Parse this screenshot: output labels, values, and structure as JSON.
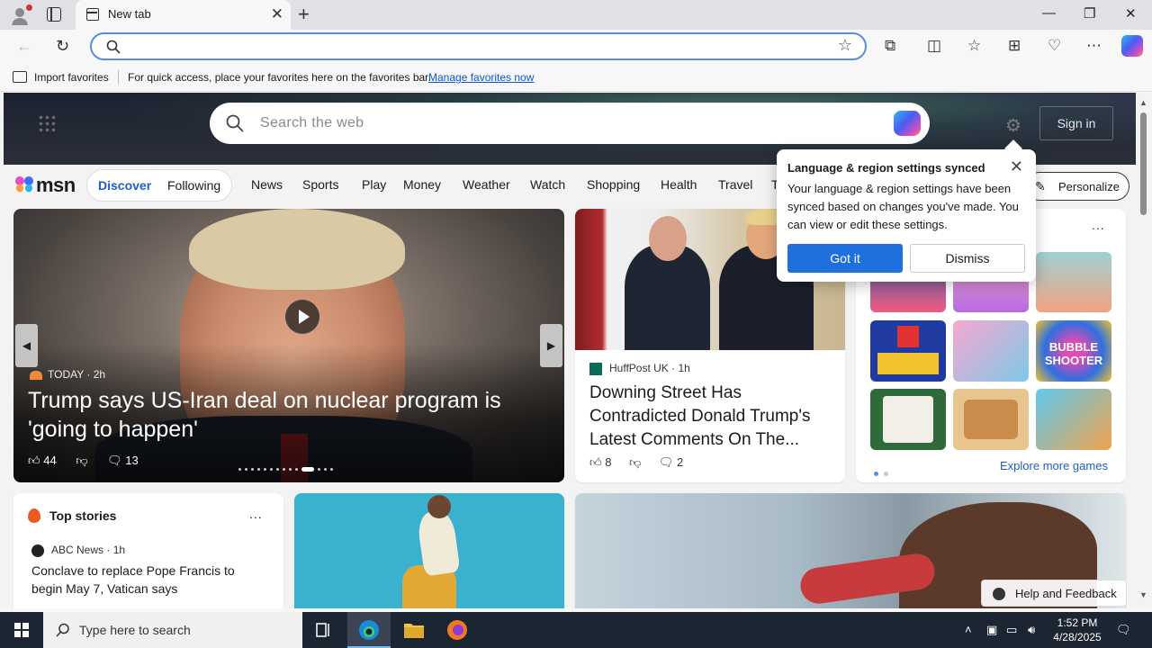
{
  "browser": {
    "tab_title": "New tab",
    "tab_close": "✕",
    "new_tab": "+",
    "window_controls": {
      "minimize": "—",
      "restore": "❐",
      "close": "✕"
    },
    "address_placeholder": "",
    "favorites_bar": {
      "import_label": "Import favorites",
      "hint": "For quick access, place your favorites here on the favorites bar.",
      "manage_link": "Manage favorites now"
    }
  },
  "msn": {
    "search_placeholder": "Search the web",
    "sign_in": "Sign in",
    "logo_text": "msn",
    "feed_tabs": {
      "discover": "Discover",
      "following": "Following"
    },
    "categories": [
      "News",
      "Sports",
      "Play",
      "Money",
      "Weather",
      "Watch",
      "Shopping",
      "Health",
      "Travel",
      "T"
    ],
    "personalize": "Personalize",
    "hero": {
      "source": "TODAY",
      "age": "2h",
      "title": "Trump says US-Iran deal on nuclear program is 'going to happen'",
      "likes": "44",
      "comments": "13"
    },
    "huffpost": {
      "source": "HuffPost UK",
      "age": "1h",
      "title": "Downing Street Has Contradicted Donald Trump's Latest Comments On The...",
      "likes": "8",
      "comments": "2"
    },
    "games": {
      "more": "...",
      "explore": "Explore more games",
      "bubble_label": "BUBBLE SHOOTER"
    },
    "top_stories": {
      "title": "Top stories",
      "more": "...",
      "source": "ABC News",
      "age": "1h",
      "headline": "Conclave to replace Pope Francis to begin May 7, Vatican says"
    },
    "help": "Help and Feedback"
  },
  "popup": {
    "title": "Language & region settings synced",
    "body": "Your language & region settings have been synced based on changes you've made. You can view or edit these settings.",
    "primary": "Got it",
    "secondary": "Dismiss"
  },
  "taskbar": {
    "search_placeholder": "Type here to search",
    "time": "1:52 PM",
    "date": "4/28/2025"
  },
  "colors": {
    "accent": "#1f6fde",
    "link": "#1c5fc7",
    "taskbar": "#1c2633"
  }
}
